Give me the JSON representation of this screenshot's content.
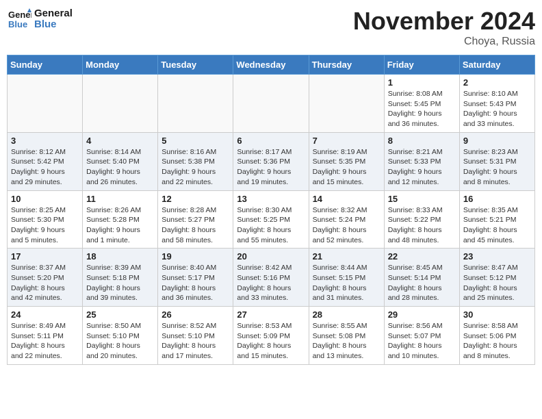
{
  "header": {
    "logo_line1": "General",
    "logo_line2": "Blue",
    "month": "November 2024",
    "location": "Choya, Russia"
  },
  "weekdays": [
    "Sunday",
    "Monday",
    "Tuesday",
    "Wednesday",
    "Thursday",
    "Friday",
    "Saturday"
  ],
  "weeks": [
    [
      {
        "day": "",
        "info": ""
      },
      {
        "day": "",
        "info": ""
      },
      {
        "day": "",
        "info": ""
      },
      {
        "day": "",
        "info": ""
      },
      {
        "day": "",
        "info": ""
      },
      {
        "day": "1",
        "info": "Sunrise: 8:08 AM\nSunset: 5:45 PM\nDaylight: 9 hours and 36 minutes."
      },
      {
        "day": "2",
        "info": "Sunrise: 8:10 AM\nSunset: 5:43 PM\nDaylight: 9 hours and 33 minutes."
      }
    ],
    [
      {
        "day": "3",
        "info": "Sunrise: 8:12 AM\nSunset: 5:42 PM\nDaylight: 9 hours and 29 minutes."
      },
      {
        "day": "4",
        "info": "Sunrise: 8:14 AM\nSunset: 5:40 PM\nDaylight: 9 hours and 26 minutes."
      },
      {
        "day": "5",
        "info": "Sunrise: 8:16 AM\nSunset: 5:38 PM\nDaylight: 9 hours and 22 minutes."
      },
      {
        "day": "6",
        "info": "Sunrise: 8:17 AM\nSunset: 5:36 PM\nDaylight: 9 hours and 19 minutes."
      },
      {
        "day": "7",
        "info": "Sunrise: 8:19 AM\nSunset: 5:35 PM\nDaylight: 9 hours and 15 minutes."
      },
      {
        "day": "8",
        "info": "Sunrise: 8:21 AM\nSunset: 5:33 PM\nDaylight: 9 hours and 12 minutes."
      },
      {
        "day": "9",
        "info": "Sunrise: 8:23 AM\nSunset: 5:31 PM\nDaylight: 9 hours and 8 minutes."
      }
    ],
    [
      {
        "day": "10",
        "info": "Sunrise: 8:25 AM\nSunset: 5:30 PM\nDaylight: 9 hours and 5 minutes."
      },
      {
        "day": "11",
        "info": "Sunrise: 8:26 AM\nSunset: 5:28 PM\nDaylight: 9 hours and 1 minute."
      },
      {
        "day": "12",
        "info": "Sunrise: 8:28 AM\nSunset: 5:27 PM\nDaylight: 8 hours and 58 minutes."
      },
      {
        "day": "13",
        "info": "Sunrise: 8:30 AM\nSunset: 5:25 PM\nDaylight: 8 hours and 55 minutes."
      },
      {
        "day": "14",
        "info": "Sunrise: 8:32 AM\nSunset: 5:24 PM\nDaylight: 8 hours and 52 minutes."
      },
      {
        "day": "15",
        "info": "Sunrise: 8:33 AM\nSunset: 5:22 PM\nDaylight: 8 hours and 48 minutes."
      },
      {
        "day": "16",
        "info": "Sunrise: 8:35 AM\nSunset: 5:21 PM\nDaylight: 8 hours and 45 minutes."
      }
    ],
    [
      {
        "day": "17",
        "info": "Sunrise: 8:37 AM\nSunset: 5:20 PM\nDaylight: 8 hours and 42 minutes."
      },
      {
        "day": "18",
        "info": "Sunrise: 8:39 AM\nSunset: 5:18 PM\nDaylight: 8 hours and 39 minutes."
      },
      {
        "day": "19",
        "info": "Sunrise: 8:40 AM\nSunset: 5:17 PM\nDaylight: 8 hours and 36 minutes."
      },
      {
        "day": "20",
        "info": "Sunrise: 8:42 AM\nSunset: 5:16 PM\nDaylight: 8 hours and 33 minutes."
      },
      {
        "day": "21",
        "info": "Sunrise: 8:44 AM\nSunset: 5:15 PM\nDaylight: 8 hours and 31 minutes."
      },
      {
        "day": "22",
        "info": "Sunrise: 8:45 AM\nSunset: 5:14 PM\nDaylight: 8 hours and 28 minutes."
      },
      {
        "day": "23",
        "info": "Sunrise: 8:47 AM\nSunset: 5:12 PM\nDaylight: 8 hours and 25 minutes."
      }
    ],
    [
      {
        "day": "24",
        "info": "Sunrise: 8:49 AM\nSunset: 5:11 PM\nDaylight: 8 hours and 22 minutes."
      },
      {
        "day": "25",
        "info": "Sunrise: 8:50 AM\nSunset: 5:10 PM\nDaylight: 8 hours and 20 minutes."
      },
      {
        "day": "26",
        "info": "Sunrise: 8:52 AM\nSunset: 5:10 PM\nDaylight: 8 hours and 17 minutes."
      },
      {
        "day": "27",
        "info": "Sunrise: 8:53 AM\nSunset: 5:09 PM\nDaylight: 8 hours and 15 minutes."
      },
      {
        "day": "28",
        "info": "Sunrise: 8:55 AM\nSunset: 5:08 PM\nDaylight: 8 hours and 13 minutes."
      },
      {
        "day": "29",
        "info": "Sunrise: 8:56 AM\nSunset: 5:07 PM\nDaylight: 8 hours and 10 minutes."
      },
      {
        "day": "30",
        "info": "Sunrise: 8:58 AM\nSunset: 5:06 PM\nDaylight: 8 hours and 8 minutes."
      }
    ]
  ]
}
